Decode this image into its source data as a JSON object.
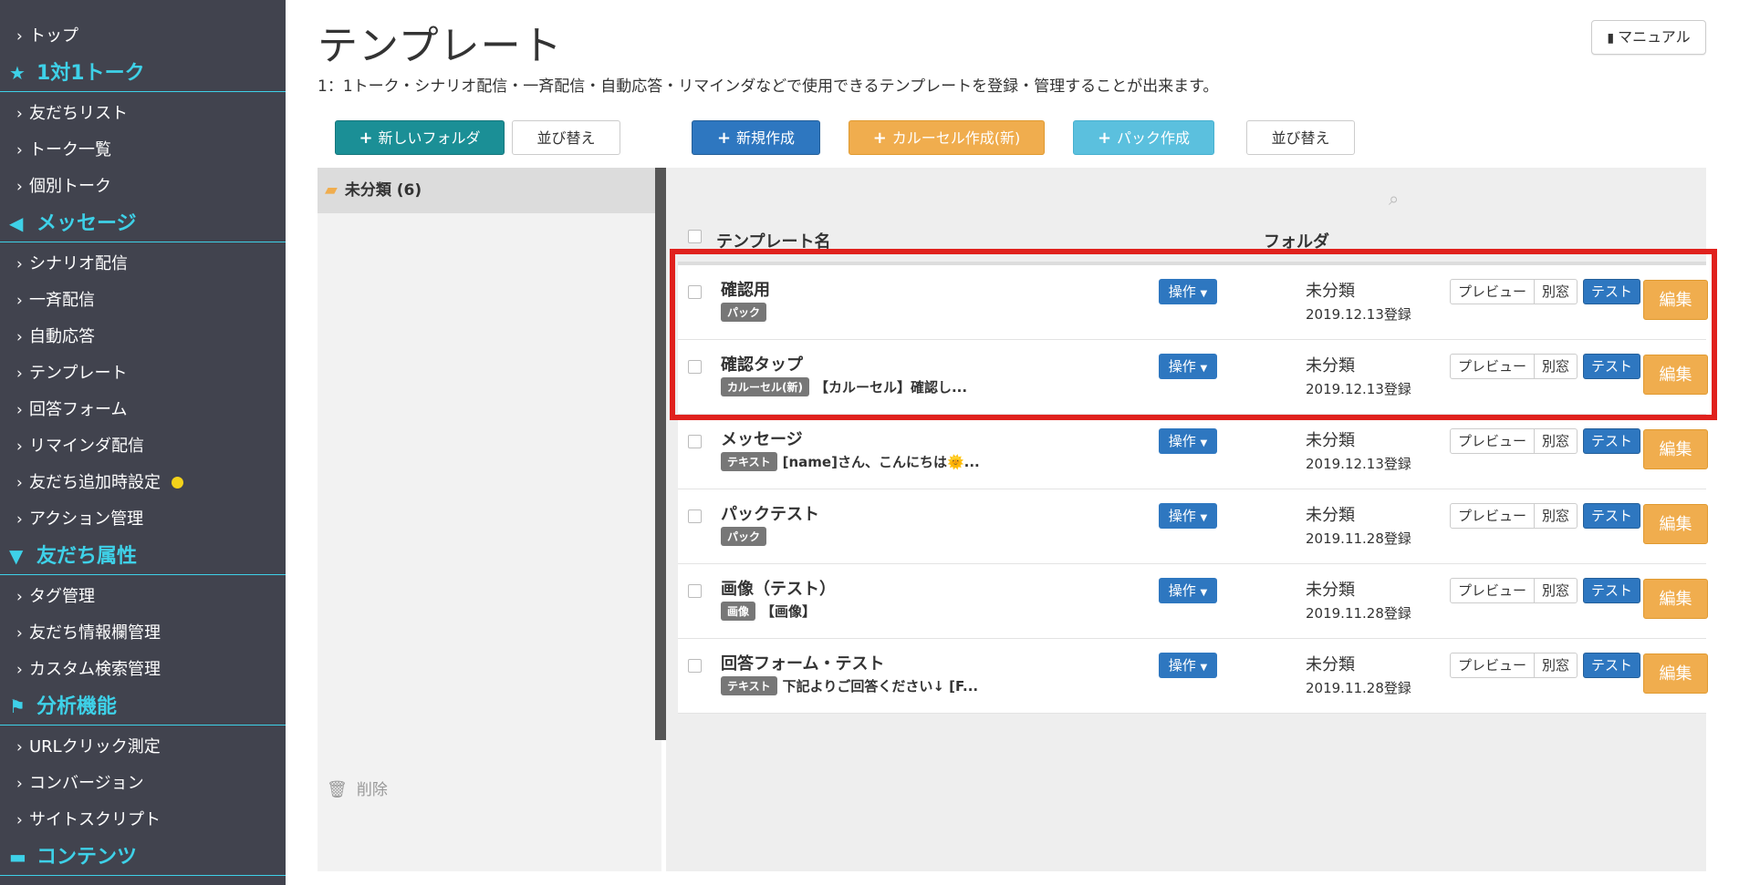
{
  "sidebar": {
    "top_item": "トップ",
    "sections": [
      {
        "icon": "star-icon",
        "glyph": "★",
        "title": "1対1トーク",
        "items": [
          "友だちリスト",
          "トーク一覧",
          "個別トーク"
        ]
      },
      {
        "icon": "megaphone-icon",
        "glyph": "📢",
        "title": "メッセージ",
        "items": [
          "シナリオ配信",
          "一斉配信",
          "自動応答",
          "テンプレート",
          "回答フォーム",
          "リマインダ配信",
          "友だち追加時設定",
          "アクション管理"
        ]
      },
      {
        "icon": "filter-icon",
        "glyph": "▼",
        "title": "友だち属性",
        "items": [
          "タグ管理",
          "友だち情報欄管理",
          "カスタム検索管理"
        ]
      },
      {
        "icon": "flag-icon",
        "glyph": "⚑",
        "title": "分析機能",
        "items": [
          "URLクリック測定",
          "コンバージョン",
          "サイトスクリプト"
        ]
      },
      {
        "icon": "folder-open-icon",
        "glyph": "📂",
        "title": "コンテンツ",
        "items": []
      }
    ],
    "notify_dot_item": "友だち追加時設定",
    "notify_dot_color": "#f3d21a"
  },
  "header": {
    "title": "テンプレート",
    "description": "1：1トーク・シナリオ配信・一斉配信・自動応答・リマインダなどで使用できるテンプレートを登録・管理することが出来ます。",
    "manual_label": "マニュアル"
  },
  "toolbar": {
    "new_folder": "新しいフォルダ",
    "folder_sort": "並び替え",
    "new_create": "新規作成",
    "carousel_create": "カルーセル作成(新)",
    "pack_create": "パック作成",
    "template_sort": "並び替え"
  },
  "folders": {
    "items": [
      {
        "label": "未分類 (6)"
      }
    ],
    "delete_label": "削除"
  },
  "table": {
    "headers": {
      "name": "テンプレート名",
      "folder": "フォルダ"
    },
    "op_label": "操作",
    "preview_label": "プレビュー",
    "new_window_label": "別窓",
    "test_label": "テスト",
    "edit_label": "編集",
    "rows": [
      {
        "name": "確認用",
        "badge": "パック",
        "snippet": "",
        "folder": "未分類",
        "date": "2019.12.13登録"
      },
      {
        "name": "確認タップ",
        "badge": "カルーセル(新)",
        "snippet": "【カルーセル】確認し...",
        "folder": "未分類",
        "date": "2019.12.13登録"
      },
      {
        "name": "メッセージ",
        "badge": "テキスト",
        "snippet": "[name]さん、こんにちは🌞...",
        "folder": "未分類",
        "date": "2019.12.13登録"
      },
      {
        "name": "パックテスト",
        "badge": "パック",
        "snippet": "",
        "folder": "未分類",
        "date": "2019.11.28登録"
      },
      {
        "name": "画像（テスト）",
        "badge": "画像",
        "snippet": "【画像】",
        "folder": "未分類",
        "date": "2019.11.28登録"
      },
      {
        "name": "回答フォーム・テスト",
        "badge": "テキスト",
        "snippet": "下記よりご回答ください↓ [F...",
        "folder": "未分類",
        "date": "2019.11.28登録"
      }
    ]
  },
  "colors": {
    "sidebar_bg": "#41434e",
    "accent_cyan": "#3ed1e8",
    "teal": "#1b8f96",
    "primary_blue": "#2e77c0",
    "warning_orange": "#f0ad4e",
    "info_cyan": "#5bc0de",
    "highlight_red": "#e0211d"
  }
}
